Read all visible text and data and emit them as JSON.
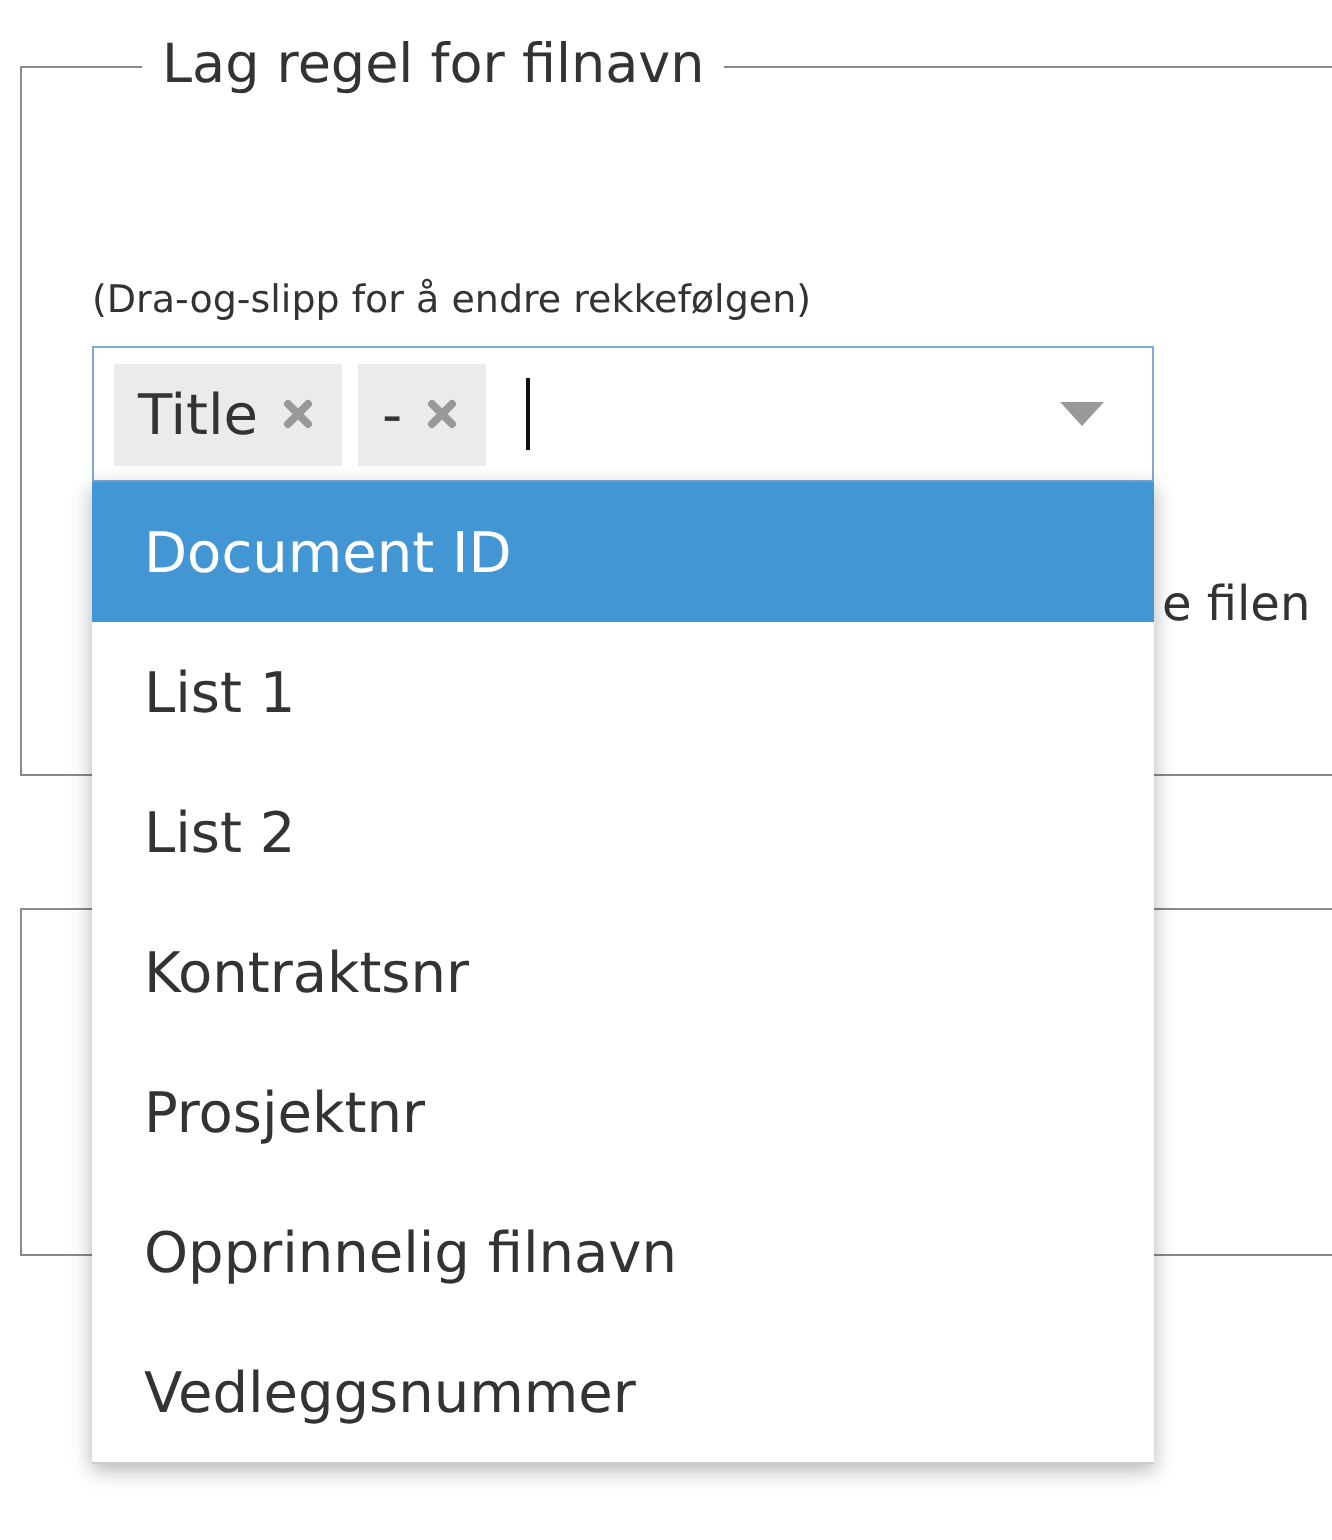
{
  "rule_panel": {
    "legend": "Lag regel for filnavn",
    "hint": "(Dra-og-slipp for å endre rekkefølgen)",
    "tags": [
      {
        "label": "Title"
      },
      {
        "label": "-"
      }
    ],
    "covered_text": "e filen"
  },
  "dropdown": {
    "options": [
      {
        "label": "Document ID",
        "selected": true
      },
      {
        "label": "List 1",
        "selected": false
      },
      {
        "label": "List 2",
        "selected": false
      },
      {
        "label": "Kontraktsnr",
        "selected": false
      },
      {
        "label": "Prosjektnr",
        "selected": false
      },
      {
        "label": "Opprinnelig filnavn",
        "selected": false
      },
      {
        "label": "Vedleggsnummer",
        "selected": false
      }
    ]
  }
}
